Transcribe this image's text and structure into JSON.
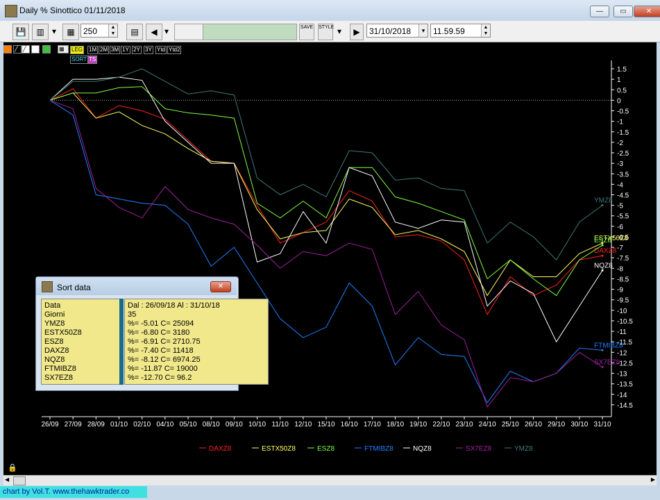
{
  "window": {
    "title": "Daily % Sinottico 01/11/2018"
  },
  "toolbar": {
    "bars_count": "250",
    "save_label": "SAVE",
    "style_label": "STYLE",
    "date": "31/10/2018",
    "time": "11.59.59"
  },
  "mini_toolbar": {
    "buttons": [
      "LEG",
      "1M",
      "2M",
      "3M",
      "1Y",
      "2Y",
      "3Y",
      "Ytd",
      "Ytd2",
      "SORT",
      "TS"
    ]
  },
  "sort_panel": {
    "title": "Sort data",
    "labels": [
      "Data",
      "Giorni",
      "YMZ8",
      "ESTX50Z8",
      "ESZ8",
      "DAXZ8",
      "NQZ8",
      "FTMIBZ8",
      "SX7EZ8"
    ],
    "values": [
      "Dal : 26/09/18 Al : 31/10/18",
      "35",
      "%= -5.01 C= 25094",
      "%= -6.80 C= 3180",
      "%= -6.91 C= 2710.75",
      "%= -7.40 C= 11418",
      "%= -8.12 C= 6974.25",
      "%= -11.87 C= 19000",
      "%= -12.70 C= 96.2"
    ]
  },
  "credit": "chart by Vol.T. www.thehawktrader.co",
  "chart_data": {
    "type": "line",
    "categories": [
      "26/09",
      "27/09",
      "28/09",
      "01/10",
      "02/10",
      "04/10",
      "05/10",
      "08/10",
      "09/10",
      "10/10",
      "11/10",
      "12/10",
      "15/10",
      "16/10",
      "17/10",
      "18/10",
      "19/10",
      "22/10",
      "23/10",
      "24/10",
      "25/10",
      "26/10",
      "29/10",
      "30/10",
      "31/10"
    ],
    "ylim": [
      -14.8,
      1.7
    ],
    "yticks": [
      1.5,
      1,
      0.5,
      0,
      -0.5,
      -1,
      -1.5,
      -2,
      -2.5,
      -3,
      -3.5,
      -4,
      -4.5,
      -5,
      -5.5,
      -6,
      -6.5,
      -7,
      -7.5,
      -8,
      -8.5,
      -9,
      -9.5,
      -10,
      -10.5,
      -11,
      -11.5,
      -12,
      -12.5,
      -13,
      -13.5,
      -14,
      -14.5
    ],
    "zero_line": true,
    "series": [
      {
        "name": "DAXZ8",
        "color": "#ff2020",
        "values": [
          0,
          0.55,
          -0.85,
          -0.25,
          -0.5,
          -0.9,
          -1.9,
          -2.9,
          -3.0,
          -5.0,
          -6.8,
          -6.3,
          -5.8,
          -4.3,
          -4.8,
          -6.5,
          -6.4,
          -6.7,
          -7.6,
          -10.2,
          -8.4,
          -9.3,
          -8.8,
          -7.6,
          -7.4
        ]
      },
      {
        "name": "ESTX50Z8",
        "color": "#ffff60",
        "values": [
          0,
          0.35,
          -0.85,
          -0.55,
          -1.2,
          -1.6,
          -2.3,
          -2.9,
          -3.0,
          -5.2,
          -6.6,
          -6.3,
          -6.2,
          -4.7,
          -5.1,
          -6.4,
          -6.2,
          -6.6,
          -7.2,
          -9.3,
          -7.6,
          -8.4,
          -8.4,
          -7.3,
          -6.8
        ]
      },
      {
        "name": "ESZ8",
        "color": "#80ff40",
        "values": [
          0,
          0.35,
          0.35,
          0.6,
          0.65,
          -0.4,
          -0.6,
          -0.7,
          -0.85,
          -4.9,
          -5.6,
          -4.8,
          -5.6,
          -3.2,
          -3.2,
          -4.6,
          -4.9,
          -5.3,
          -5.7,
          -8.5,
          -7.6,
          -8.5,
          -9.3,
          -7.6,
          -6.9
        ]
      },
      {
        "name": "FTMIBZ8",
        "color": "#2080ff",
        "values": [
          0,
          -0.7,
          -4.5,
          -4.7,
          -4.9,
          -5.0,
          -5.9,
          -7.9,
          -7.0,
          -8.7,
          -10.4,
          -11.3,
          -10.8,
          -8.7,
          -9.8,
          -12.6,
          -11.3,
          -12.1,
          -12.2,
          -14.4,
          -12.9,
          -13.4,
          -13.0,
          -11.8,
          -11.9
        ]
      },
      {
        "name": "NQZ8",
        "color": "#ffffff",
        "values": [
          0,
          1.0,
          1.0,
          1.1,
          0.95,
          -1.0,
          -2.0,
          -3.0,
          -3.0,
          -7.7,
          -7.3,
          -5.3,
          -6.8,
          -3.2,
          -3.6,
          -5.8,
          -6.1,
          -5.7,
          -5.8,
          -9.8,
          -8.6,
          -9.2,
          -11.5,
          -9.8,
          -8.1
        ]
      },
      {
        "name": "SX7EZ8",
        "color": "#a020a0",
        "values": [
          0,
          -0.4,
          -4.2,
          -5.1,
          -5.6,
          -4.1,
          -5.2,
          -5.6,
          -5.9,
          -6.9,
          -8.0,
          -7.2,
          -7.4,
          -6.8,
          -7.1,
          -10.2,
          -9.1,
          -10.7,
          -11.4,
          -14.6,
          -13.2,
          -13.4,
          -13.0,
          -12.0,
          -12.7
        ]
      },
      {
        "name": "YMZ8",
        "color": "#407878",
        "values": [
          0,
          0.9,
          0.9,
          1.1,
          1.5,
          0.9,
          0.3,
          0.45,
          0.25,
          -3.7,
          -4.5,
          -4.0,
          -4.6,
          -2.4,
          -2.5,
          -3.8,
          -3.7,
          -4.2,
          -4.3,
          -6.8,
          -5.8,
          -6.5,
          -7.6,
          -5.8,
          -5.0
        ]
      }
    ],
    "legend_placement": "bottom"
  },
  "colors": {
    "chart_bg": "#000000",
    "axis_text": "#ffffff",
    "panel_yellow": "#f0e88a"
  }
}
